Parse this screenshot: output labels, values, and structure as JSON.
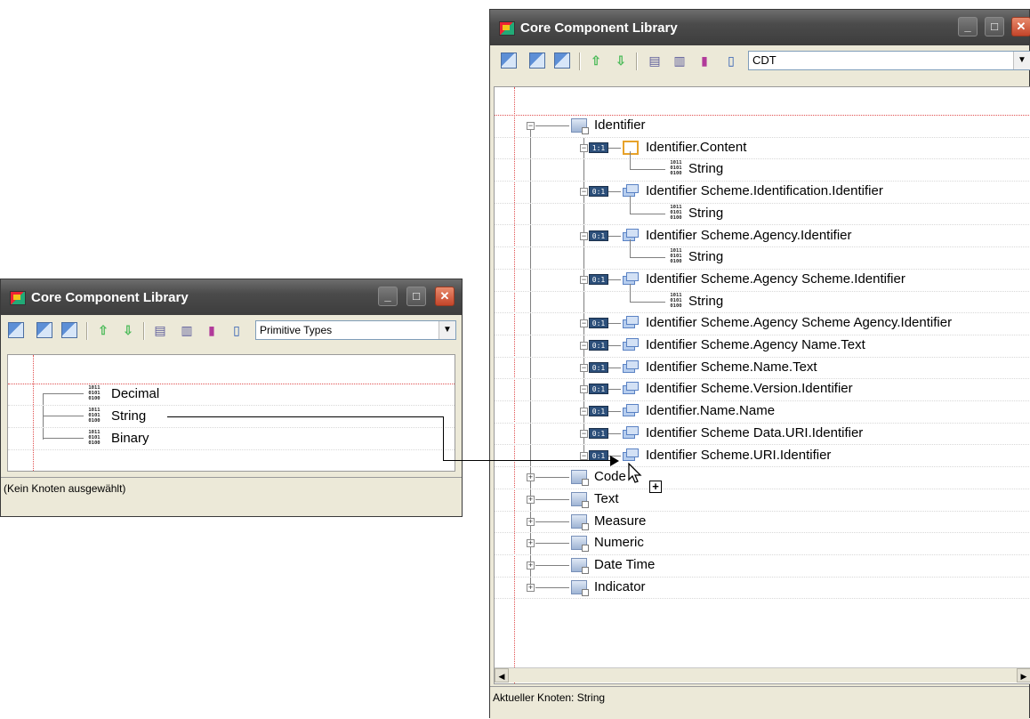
{
  "small_window": {
    "title": "Core Component Library",
    "combo_value": "Primitive Types",
    "items": [
      {
        "label": "Decimal",
        "icon": "binary-type-icon"
      },
      {
        "label": "String",
        "icon": "binary-type-icon"
      },
      {
        "label": "Binary",
        "icon": "binary-type-icon"
      }
    ],
    "status": "(Kein Knoten ausgewählt)"
  },
  "large_window": {
    "title": "Core Component Library",
    "combo_value": "CDT",
    "status": "Aktueller Knoten: String",
    "root": {
      "label": "Identifier",
      "icon": "data-type-icon"
    },
    "children": [
      {
        "label": "Identifier.Content",
        "cardinality": "1:1",
        "type": "String"
      },
      {
        "label": "Identifier  Scheme.Identification.Identifier",
        "cardinality": "0:1",
        "type": "String"
      },
      {
        "label": "Identifier Scheme.Agency.Identifier",
        "cardinality": "0:1",
        "type": "String"
      },
      {
        "label": "Identifier Scheme.Agency Scheme.Identifier",
        "cardinality": "0:1",
        "type": "String"
      },
      {
        "label": "Identifier Scheme.Agency Scheme Agency.Identifier",
        "cardinality": "0:1"
      },
      {
        "label": "Identifier Scheme.Agency Name.Text",
        "cardinality": "0:1"
      },
      {
        "label": "Identifier Scheme.Name.Text",
        "cardinality": "0:1"
      },
      {
        "label": "Identifier Scheme.Version.Identifier",
        "cardinality": "0:1"
      },
      {
        "label": "Identifier.Name.Name",
        "cardinality": "0:1"
      },
      {
        "label": "Identifier Scheme Data.URI.Identifier",
        "cardinality": "0:1"
      },
      {
        "label": "Identifier Scheme.URI.Identifier",
        "cardinality": "0:1"
      }
    ],
    "other_types": [
      "Code",
      "Text",
      "Measure",
      "Numeric",
      "Date Time",
      "Indicator"
    ]
  },
  "binary_icon_text": "1011\n0101\n0100",
  "colors": {
    "titlebar": "#4b4b4b",
    "close_button": "#c4452a",
    "guide_line": "#e05050",
    "window_bg": "#ece9d8"
  }
}
